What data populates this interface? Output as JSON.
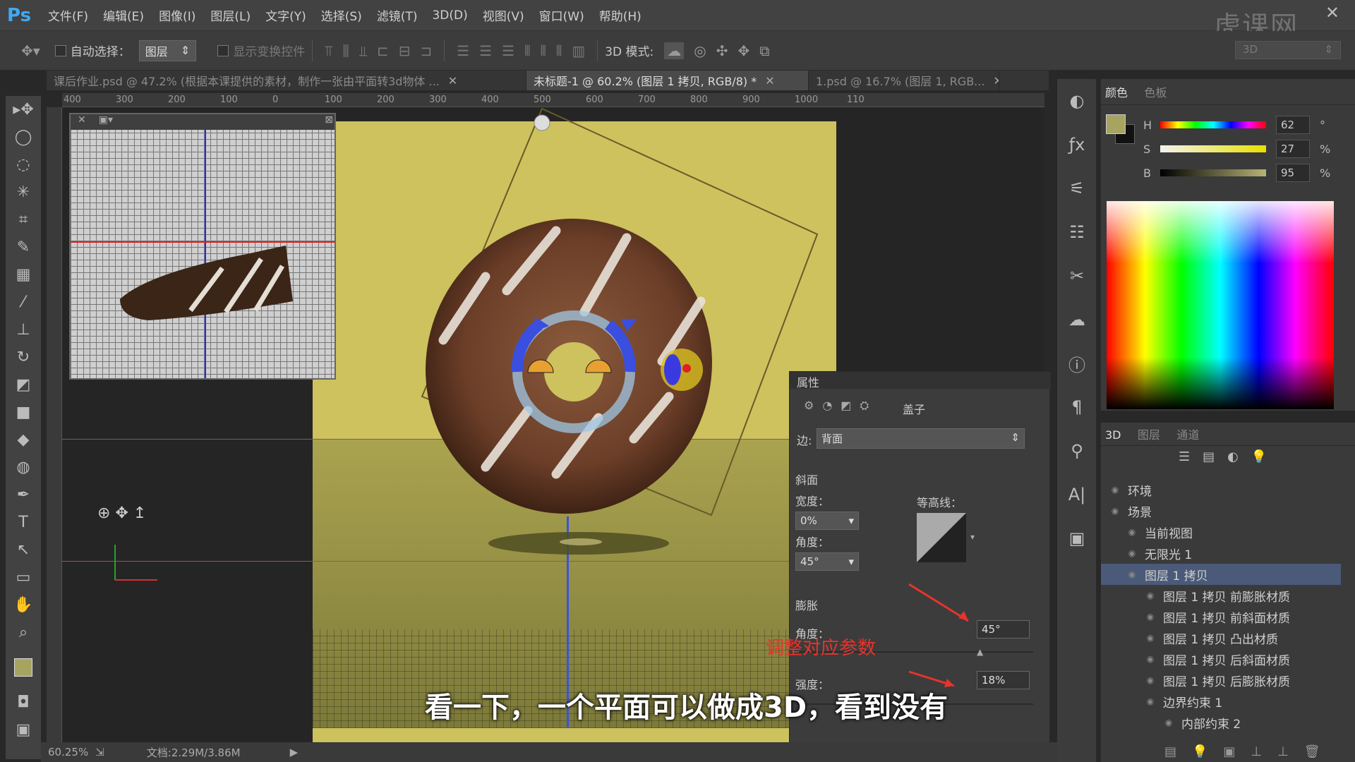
{
  "app": {
    "logo": "Ps",
    "watermark": "虎课网"
  },
  "menu": [
    "文件(F)",
    "编辑(E)",
    "图像(I)",
    "图层(L)",
    "文字(Y)",
    "选择(S)",
    "滤镜(T)",
    "3D(D)",
    "视图(V)",
    "窗口(W)",
    "帮助(H)"
  ],
  "options": {
    "auto_select": "自动选择：",
    "target": "图层",
    "show_transform": "显示变换控件",
    "mode_3d": "3D 模式:",
    "workspace": "3D"
  },
  "tabs": [
    {
      "label": "课后作业.psd @ 47.2% (根据本课提供的素材，制作一张由平面转3d物体 ..."
    },
    {
      "label": "未标题-1 @ 60.2% (图层 1 拷贝, RGB/8) *"
    },
    {
      "label": "1.psd @ 16.7% (图层 1, RGB..."
    }
  ],
  "ruler": [
    "400",
    "300",
    "200",
    "100",
    "0",
    "100",
    "200",
    "300",
    "400",
    "500",
    "600",
    "700",
    "800",
    "900",
    "1000",
    "110"
  ],
  "color": {
    "tabs": [
      "颜色",
      "色板"
    ],
    "h": {
      "label": "H",
      "value": "62",
      "unit": "°"
    },
    "s": {
      "label": "S",
      "value": "27",
      "unit": "%"
    },
    "b": {
      "label": "B",
      "value": "95",
      "unit": "%"
    },
    "fg": "#a7a462"
  },
  "layers": {
    "tabs": [
      "3D",
      "图层",
      "通道"
    ],
    "items": [
      "环境",
      "场景",
      "当前视图",
      "无限光 1",
      "图层 1 拷贝",
      "图层 1 拷贝 前膨胀材质",
      "图层 1 拷贝 前斜面材质",
      "图层 1 拷贝 凸出材质",
      "图层 1 拷贝 后斜面材质",
      "图层 1 拷贝 后膨胀材质",
      "边界约束 1",
      "内部约束 2"
    ]
  },
  "properties": {
    "title": "属性",
    "cap_label": "盖子",
    "side_label": "边:",
    "side_value": "背面",
    "bevel": "斜面",
    "width_label": "宽度：",
    "width_value": "0%",
    "angle_label": "角度：",
    "angle_value": "45°",
    "contour_label": "等高线：",
    "inflate": "膨胀",
    "inflate_angle_label": "角度：",
    "inflate_angle_value": "45°",
    "strength_label": "强度：",
    "strength_value": "18%"
  },
  "note": "调整对应参数",
  "subtitle": "看一下，一个平面可以做成3D，看到没有",
  "status": {
    "zoom": "60.25%",
    "doc": "文档:2.29M/3.86M"
  }
}
